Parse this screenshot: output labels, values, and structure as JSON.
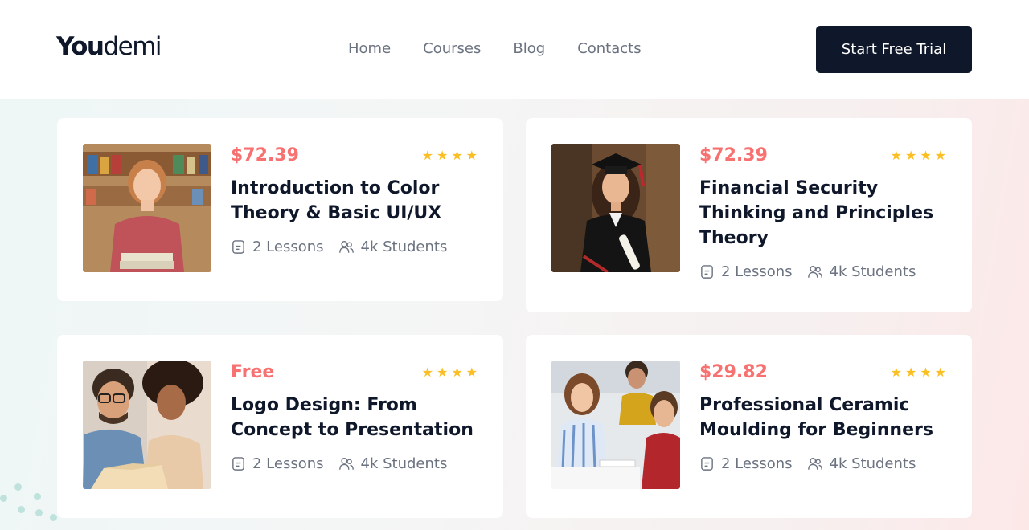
{
  "header": {
    "logo_bold": "You",
    "logo_light": "demi",
    "nav": [
      "Home",
      "Courses",
      "Blog",
      "Contacts"
    ],
    "cta_label": "Start Free Trial"
  },
  "colors": {
    "accent_price": "#f87171",
    "dark": "#0f172a",
    "star": "#fbbf24",
    "muted_text": "#6b7280"
  },
  "courses": [
    {
      "price": "$72.39",
      "rating_stars": 4,
      "title": "Introduction to Color Theory & Basic UI/UX",
      "lessons": "2 Lessons",
      "students": "4k Students",
      "image": "student-woman-with-books"
    },
    {
      "price": "$72.39",
      "rating_stars": 4,
      "title": "Financial Security Thinking and Principles Theory",
      "lessons": "2 Lessons",
      "students": "4k Students",
      "image": "graduate-woman-with-diploma"
    },
    {
      "price": "Free",
      "rating_stars": 4,
      "title": "Logo Design: From Concept to Presentation",
      "lessons": "2 Lessons",
      "students": "4k Students",
      "image": "two-students-reading"
    },
    {
      "price": "$29.82",
      "rating_stars": 4,
      "title": "Professional Ceramic Moulding for Beginners",
      "lessons": "2 Lessons",
      "students": "4k Students",
      "image": "students-in-classroom"
    }
  ]
}
